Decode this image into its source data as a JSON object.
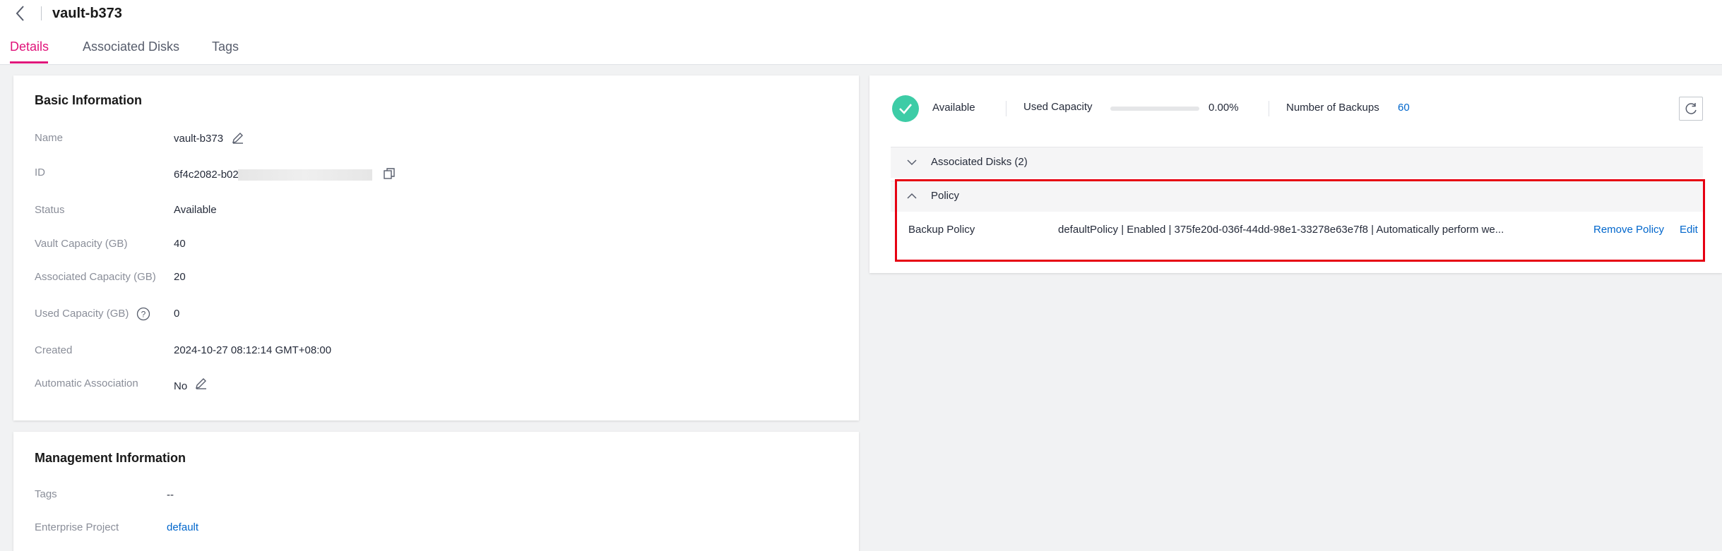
{
  "header": {
    "title": "vault-b373",
    "tabs": [
      {
        "label": "Details",
        "active": true
      },
      {
        "label": "Associated Disks",
        "active": false
      },
      {
        "label": "Tags",
        "active": false
      }
    ]
  },
  "basic": {
    "title": "Basic Information",
    "rows": [
      {
        "label": "Name",
        "value": "vault-b373"
      },
      {
        "label": "ID",
        "value": "6f4c2082-b020-4"
      },
      {
        "label": "Status",
        "value": "Available"
      },
      {
        "label": "Vault Capacity (GB)",
        "value": "40"
      },
      {
        "label": "Associated Capacity (GB)",
        "value": "20"
      },
      {
        "label": "Used Capacity (GB)",
        "value": "0"
      },
      {
        "label": "Created",
        "value": "2024-10-27 08:12:14 GMT+08:00"
      },
      {
        "label": "Automatic Association",
        "value": "No"
      }
    ]
  },
  "management": {
    "title": "Management Information",
    "rows": [
      {
        "label": "Tags",
        "value": "--"
      },
      {
        "label": "Enterprise Project",
        "value": "default"
      }
    ]
  },
  "status": {
    "state": "Available",
    "used_capacity_label": "Used Capacity",
    "used_capacity_percent": "0.00%",
    "used_capacity_fraction": 0.0,
    "backups_label": "Number of Backups",
    "backups_count": "60"
  },
  "panels": {
    "associated_disks": "Associated Disks (2)",
    "policy": "Policy",
    "backup_policy_label": "Backup Policy",
    "backup_policy_value": "defaultPolicy | Enabled | 375fe20d-036f-44dd-98e1-33278e63e7f8 | Automatically perform we...",
    "remove_label": "Remove Policy",
    "edit_label": "Edit"
  },
  "colors": {
    "accent_tab": "#e0137a",
    "link": "#0066cc",
    "status_ok": "#3dcca6",
    "highlight": "#e60012"
  }
}
